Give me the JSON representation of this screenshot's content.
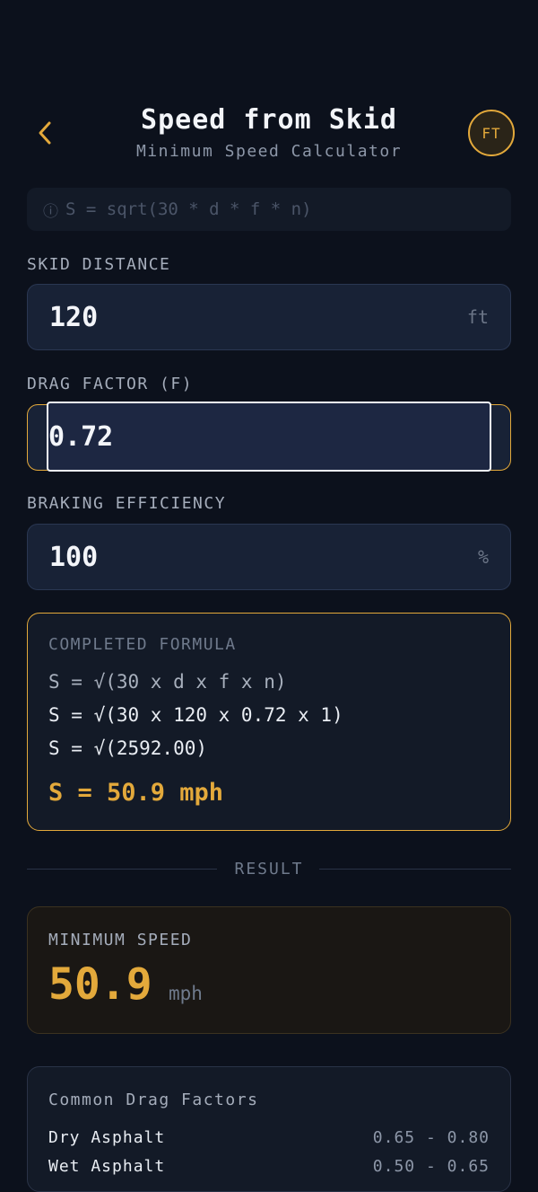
{
  "header": {
    "title": "Speed from Skid",
    "subtitle": "Minimum Speed Calculator",
    "unit_toggle": "FT"
  },
  "formula_hint": {
    "icon": "info-icon",
    "text": "S = sqrt(30 * d * f * n)"
  },
  "fields": {
    "skid_distance": {
      "label": "SKID DISTANCE",
      "value": "120",
      "unit": "ft"
    },
    "drag_factor": {
      "label": "DRAG FACTOR (F)",
      "value": "0.72"
    },
    "braking_efficiency": {
      "label": "BRAKING EFFICIENCY",
      "value": "100",
      "unit": "%"
    }
  },
  "completed_formula": {
    "label": "COMPLETED FORMULA",
    "line1": "S = √(30 x d x f x n)",
    "line2": "S = √(30 x 120 x 0.72 x 1)",
    "line3": "S = √(2592.00)",
    "result": "S = 50.9 mph"
  },
  "divider": {
    "label": "RESULT"
  },
  "result": {
    "label": "MINIMUM SPEED",
    "value": "50.9",
    "unit": "mph"
  },
  "drag_factors": {
    "title": "Common Drag Factors",
    "rows": [
      {
        "surface": "Dry Asphalt",
        "range": "0.65 - 0.80"
      },
      {
        "surface": "Wet Asphalt",
        "range": "0.50 - 0.65"
      }
    ]
  },
  "colors": {
    "background": "#0c111c",
    "accent": "#e3a93b",
    "field": "#182236"
  }
}
